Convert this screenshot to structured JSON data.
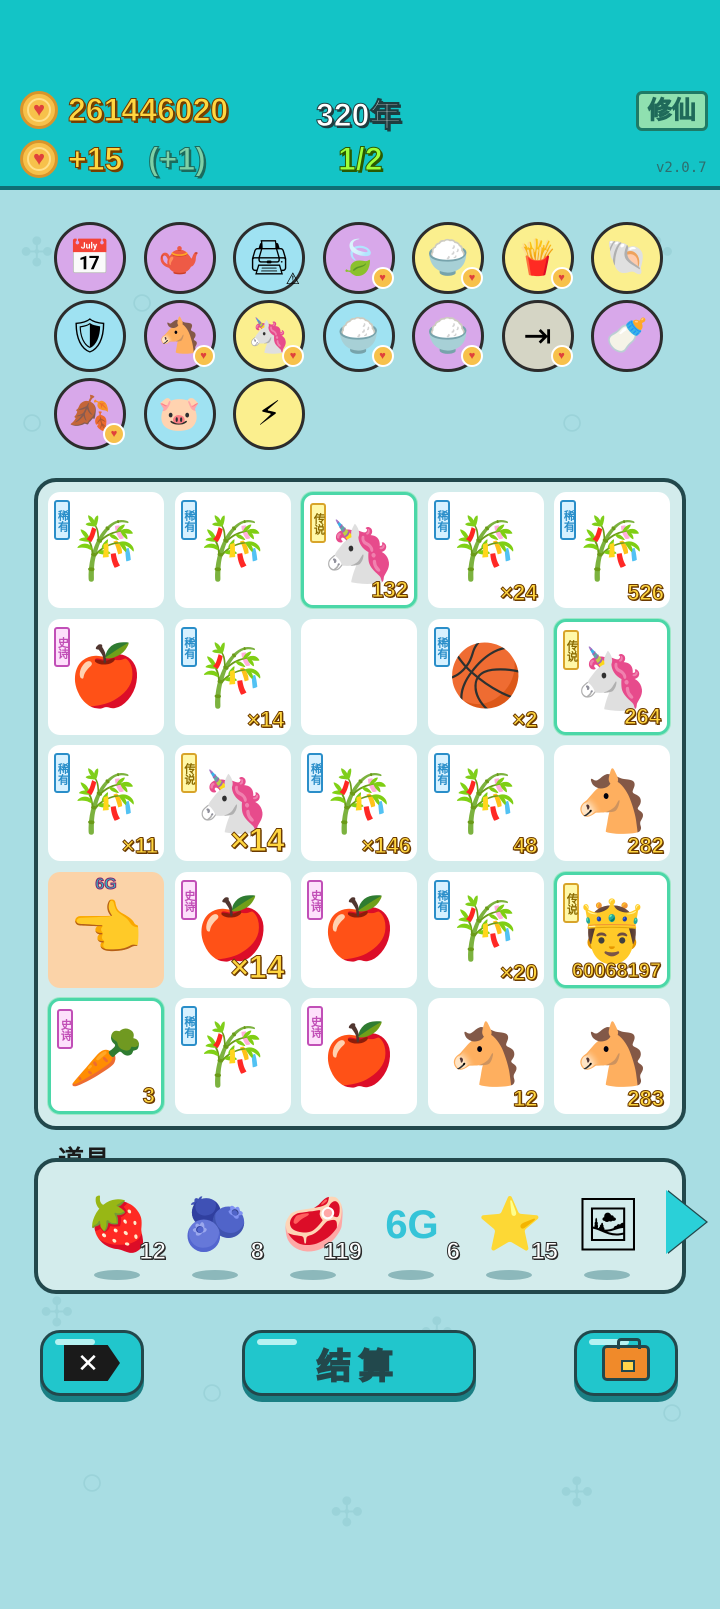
{
  "header": {
    "coins": "261446020",
    "years": "320年",
    "income": "+15",
    "income_bonus": "(+1)",
    "progress": "1/2",
    "mode_button": "修仙",
    "version": "v2.0.7"
  },
  "skills": [
    {
      "icon": "calendar-icon",
      "glyph": "📅",
      "color": "purple"
    },
    {
      "icon": "gravy-boat-icon",
      "glyph": "🫖",
      "color": "purple"
    },
    {
      "icon": "printer-icon",
      "glyph": "🖨",
      "color": "blue",
      "warning": true
    },
    {
      "icon": "leaf-icon",
      "glyph": "🍃",
      "color": "purple",
      "coin_badge": true
    },
    {
      "icon": "rice-bowl-icon",
      "glyph": "🍚",
      "color": "yellow",
      "coin_badge": true
    },
    {
      "icon": "fries-icon",
      "glyph": "🍟",
      "color": "yellow",
      "coin_badge": true
    },
    {
      "icon": "shell-icon",
      "glyph": "🐚",
      "color": "yellow"
    },
    {
      "icon": "shield-wrench-icon",
      "glyph": "🛡",
      "color": "blue"
    },
    {
      "icon": "horse-pair-icon",
      "glyph": "🐴",
      "color": "purple",
      "coin_badge": true
    },
    {
      "icon": "unicorn-icon",
      "glyph": "🦄",
      "color": "yellow",
      "coin_badge": true
    },
    {
      "icon": "rice-bowl-icon",
      "glyph": "🍚",
      "color": "blue",
      "coin_badge": true
    },
    {
      "icon": "rice-bowl-icon",
      "glyph": "🍚",
      "color": "purple",
      "coin_badge": true
    },
    {
      "icon": "skip-icon",
      "glyph": "⇥",
      "color": "grey",
      "coin_badge": true
    },
    {
      "icon": "breast-pump-icon",
      "glyph": "🍼",
      "color": "purple"
    },
    {
      "icon": "leaf-icon",
      "glyph": "🍂",
      "color": "purple",
      "coin_badge": true
    },
    {
      "icon": "piggy-bank-icon",
      "glyph": "🐷",
      "color": "blue"
    },
    {
      "icon": "lightning-icon",
      "glyph": "⚡",
      "color": "yellow"
    }
  ],
  "tags": {
    "rare": "稀有",
    "epic": "史诗",
    "legend": "传说"
  },
  "grid": [
    {
      "item": "bamboo",
      "glyph": "🎋",
      "tag": "rare",
      "count": ""
    },
    {
      "item": "bamboo",
      "glyph": "🎋",
      "tag": "rare",
      "count": ""
    },
    {
      "item": "unicorn",
      "glyph": "🦄",
      "tag": "legend",
      "count": "132",
      "highlight": true
    },
    {
      "item": "bamboo",
      "glyph": "🎋",
      "tag": "rare",
      "count": "×24"
    },
    {
      "item": "bamboo",
      "glyph": "🎋",
      "tag": "rare",
      "count": "526"
    },
    {
      "item": "apple",
      "glyph": "🍎",
      "tag": "epic",
      "count": ""
    },
    {
      "item": "bamboo",
      "glyph": "🎋",
      "tag": "rare",
      "count": "×14"
    },
    {
      "item": "empty",
      "glyph": "",
      "tag": "",
      "count": ""
    },
    {
      "item": "basketball-bamboo",
      "glyph": "🏀",
      "tag": "rare",
      "count": "×2"
    },
    {
      "item": "unicorn",
      "glyph": "🦄",
      "tag": "legend",
      "count": "264",
      "highlight": true
    },
    {
      "item": "bamboo",
      "glyph": "🎋",
      "tag": "rare",
      "count": "×11"
    },
    {
      "item": "unicorn",
      "glyph": "🦄",
      "tag": "legend",
      "count": "×14",
      "big": true
    },
    {
      "item": "bamboo",
      "glyph": "🎋",
      "tag": "rare",
      "count": "×146"
    },
    {
      "item": "bamboo",
      "glyph": "🎋",
      "tag": "rare",
      "count": "48"
    },
    {
      "item": "horse",
      "glyph": "🐴",
      "tag": "",
      "count": "282"
    },
    {
      "item": "6g-hand",
      "glyph": "👈",
      "tag": "",
      "count": "",
      "special": true,
      "label": "6G"
    },
    {
      "item": "apple",
      "glyph": "🍎",
      "tag": "epic",
      "count": "×14",
      "big": true
    },
    {
      "item": "apple",
      "glyph": "🍎",
      "tag": "epic",
      "count": ""
    },
    {
      "item": "bamboo",
      "glyph": "🎋",
      "tag": "rare",
      "count": "×20"
    },
    {
      "item": "king",
      "glyph": "🤴",
      "tag": "legend",
      "count": "60068197",
      "highlight": true,
      "small": true
    },
    {
      "item": "carrot",
      "glyph": "🥕",
      "tag": "epic",
      "count": "3",
      "highlight": true
    },
    {
      "item": "bamboo",
      "glyph": "🎋",
      "tag": "rare",
      "count": ""
    },
    {
      "item": "apple",
      "glyph": "🍎",
      "tag": "epic",
      "count": ""
    },
    {
      "item": "horse",
      "glyph": "🐴",
      "tag": "",
      "count": "12"
    },
    {
      "item": "horse",
      "glyph": "🐴",
      "tag": "",
      "count": "283"
    }
  ],
  "props": {
    "title": "道具",
    "items": [
      {
        "icon": "lychee-icon",
        "glyph": "🍓",
        "count": "12"
      },
      {
        "icon": "blueberry-icon",
        "glyph": "🫐",
        "count": "8"
      },
      {
        "icon": "liver-icon",
        "glyph": "🥩",
        "count": "119"
      },
      {
        "icon": "6g-icon",
        "glyph": "6G",
        "count": "6"
      },
      {
        "icon": "star-icon",
        "glyph": "⭐",
        "count": "15"
      },
      {
        "icon": "portrait-icon",
        "glyph": "🖼",
        "count": ""
      }
    ]
  },
  "buttons": {
    "close_glyph": "✕",
    "settle": "结算"
  }
}
